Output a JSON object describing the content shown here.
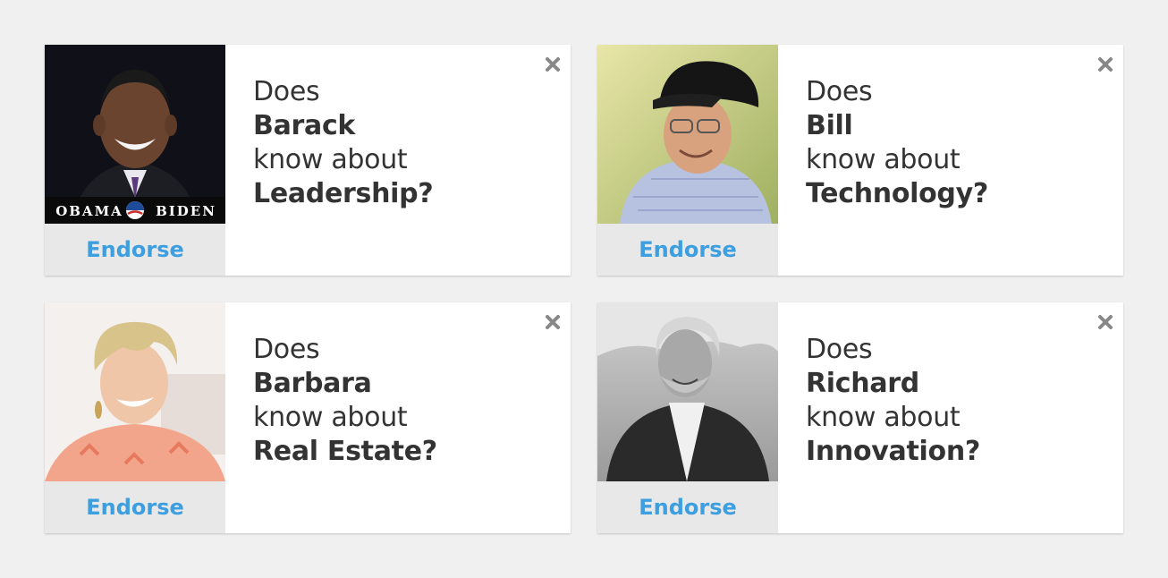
{
  "cards": [
    {
      "question_prefix": "Does",
      "name": "Barack",
      "question_middle": "know about",
      "topic": "Leadership?",
      "endorse_label": "Endorse",
      "photo_caption_left": "OBAMA",
      "photo_caption_right": "BIDEN"
    },
    {
      "question_prefix": "Does",
      "name": "Bill",
      "question_middle": "know about",
      "topic": "Technology?",
      "endorse_label": "Endorse"
    },
    {
      "question_prefix": "Does",
      "name": "Barbara",
      "question_middle": "know about",
      "topic": "Real Estate?",
      "endorse_label": "Endorse"
    },
    {
      "question_prefix": "Does",
      "name": "Richard",
      "question_middle": "know about",
      "topic": "Innovation?",
      "endorse_label": "Endorse"
    }
  ],
  "colors": {
    "background": "#f0f0f0",
    "card": "#ffffff",
    "endorse_text": "#3d9ee0",
    "endorse_bg": "#e8e8e8",
    "question_text": "#333333",
    "close_icon": "#888888"
  },
  "icons": {
    "close": "close-icon"
  }
}
